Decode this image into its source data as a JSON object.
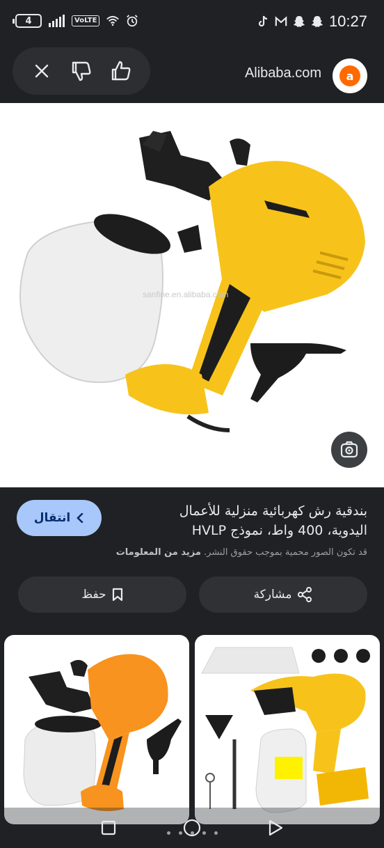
{
  "status_bar": {
    "battery": "4",
    "volte": "VoLTE",
    "time": "10:27"
  },
  "header": {
    "site_name": "Alibaba.com",
    "logo_glyph": "a"
  },
  "image": {
    "watermark": "sanfine.en.alibaba.com"
  },
  "info": {
    "title": "بندقية رش كهربائية منزلية للأعمال اليدوية، 400 واط، نموذج HVLP",
    "visit_label": "انتقال",
    "copyright_text": "قد تكون الصور محمية بموجب حقوق النشر.",
    "more_info": "مزيد من المعلومات",
    "share_label": "مشاركة",
    "save_label": "حفظ"
  },
  "colors": {
    "background": "#202124",
    "visit_button": "#a8c7fa",
    "product_yellow": "#f7c31b",
    "product_orange": "#f7931e"
  },
  "icons": {
    "close": "close-icon",
    "dislike": "thumbs-down-icon",
    "like": "thumbs-up-icon",
    "lens": "lens-icon",
    "share": "share-icon",
    "save": "bookmark-icon",
    "visit": "chevron-left-icon"
  }
}
